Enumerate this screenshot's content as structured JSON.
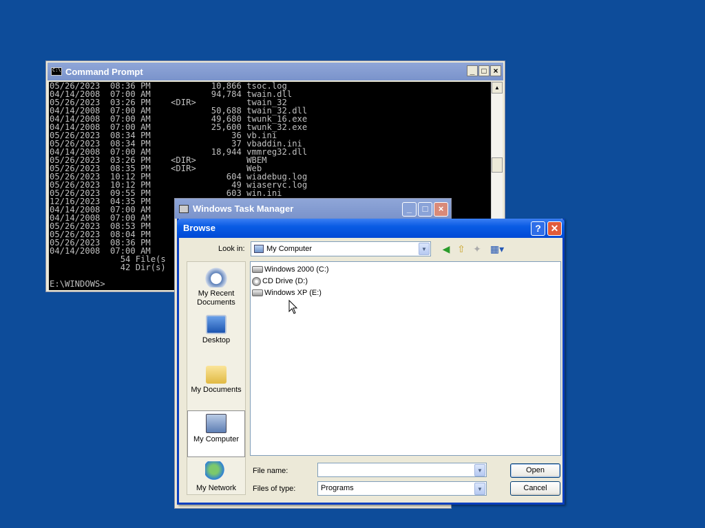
{
  "cmd": {
    "title": "Command Prompt",
    "lines": [
      "05/26/2023  08:36 PM            10,866 tsoc.log",
      "04/14/2008  07:00 AM            94,784 twain.dll",
      "05/26/2023  03:26 PM    <DIR>          twain_32",
      "04/14/2008  07:00 AM            50,688 twain_32.dll",
      "04/14/2008  07:00 AM            49,680 twunk_16.exe",
      "04/14/2008  07:00 AM            25,600 twunk_32.exe",
      "05/26/2023  08:34 PM                36 vb.ini",
      "05/26/2023  08:34 PM                37 vbaddin.ini",
      "04/14/2008  07:00 AM            18,944 vmmreg32.dll",
      "05/26/2023  03:26 PM    <DIR>          WBEM",
      "05/26/2023  08:35 PM    <DIR>          Web",
      "05/26/2023  10:12 PM               604 wiadebug.log",
      "05/26/2023  10:12 PM                49 wiaservc.log",
      "05/26/2023  09:55 PM               603 win.ini",
      "12/16/2023  04:35 PM",
      "04/14/2008  07:00 AM",
      "04/14/2008  07:00 AM",
      "05/26/2023  08:53 PM",
      "05/26/2023  08:04 PM",
      "05/26/2023  08:36 PM",
      "04/14/2008  07:00 AM",
      "              54 File(s",
      "              42 Dir(s)",
      "",
      "E:\\WINDOWS>"
    ]
  },
  "taskmanager": {
    "title": "Windows Task Manager"
  },
  "dialog": {
    "title": "Browse",
    "help_label": "?",
    "close_label": "✕",
    "lookin_label": "Look in:",
    "lookin_value": "My Computer",
    "places": [
      {
        "label": "My Recent Documents"
      },
      {
        "label": "Desktop"
      },
      {
        "label": "My Documents"
      },
      {
        "label": "My Computer"
      },
      {
        "label": "My Network"
      }
    ],
    "files": [
      {
        "name": "Windows 2000 (C:)",
        "icon": "hard-drive-icon"
      },
      {
        "name": "CD Drive (D:)",
        "icon": "cd-drive-icon"
      },
      {
        "name": "Windows XP (E:)",
        "icon": "hard-drive-icon"
      }
    ],
    "filename_label": "File name:",
    "filename_value": "",
    "filetype_label": "Files of type:",
    "filetype_value": "Programs",
    "open_label": "Open",
    "cancel_label": "Cancel"
  }
}
